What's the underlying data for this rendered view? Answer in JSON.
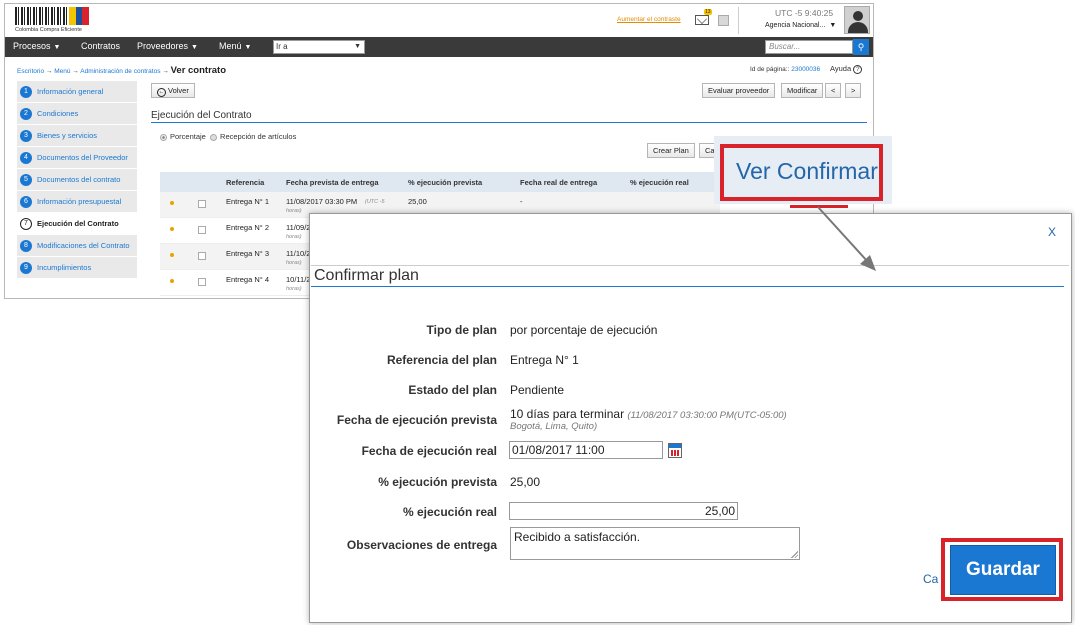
{
  "header": {
    "logo_text": "Colombia Compra Eficiente",
    "aumentar_link": "Aumentar el contraste",
    "mail_badge": "13",
    "utc": "UTC -5 9:40:25",
    "agency": "Agencia Nacional..."
  },
  "nav": {
    "items": [
      "Procesos",
      "Contratos",
      "Proveedores",
      "Menú"
    ],
    "goto_value": "Ir a",
    "search_placeholder": "Buscar..."
  },
  "breadcrumb": {
    "items": [
      "Escritorio",
      "Menú",
      "Administración de contratos"
    ],
    "current": "Ver contrato"
  },
  "page_id": {
    "label": "Id de página::",
    "value": "23000036"
  },
  "help_label": "Ayuda",
  "sidebar": {
    "steps": [
      {
        "num": "1",
        "label": "Información general"
      },
      {
        "num": "2",
        "label": "Condiciones"
      },
      {
        "num": "3",
        "label": "Bienes y servicios"
      },
      {
        "num": "4",
        "label": "Documentos del Proveedor"
      },
      {
        "num": "5",
        "label": "Documentos del contrato"
      },
      {
        "num": "6",
        "label": "Información presupuestal"
      },
      {
        "num": "7",
        "label": "Ejecución del Contrato"
      },
      {
        "num": "8",
        "label": "Modificaciones del Contrato"
      },
      {
        "num": "9",
        "label": "Incumplimientos"
      }
    ]
  },
  "toolbar": {
    "back": "Volver",
    "evaluate": "Evaluar proveedor",
    "modify": "Modificar",
    "prev": "<",
    "next": ">"
  },
  "execution": {
    "title": "Ejecución del Contrato",
    "radio_percent": "Porcentaje",
    "radio_reception": "Recepción de artículos",
    "create_plan": "Crear Plan",
    "cut_button": "Ca"
  },
  "table": {
    "headers": [
      "Referencia",
      "Fecha prevista de entrega",
      "% ejecución prevista",
      "Fecha real de entrega",
      "% ejecución real"
    ],
    "rows": [
      {
        "ref": "Entrega N° 1",
        "date": "11/08/2017 03:30 PM",
        "note": "(UTC -5",
        "note2": "horas)",
        "pct": "25,00",
        "real": "-"
      },
      {
        "ref": "Entrega N° 2",
        "date": "11/09/2",
        "note": "horas)",
        "pct": "",
        "real": ""
      },
      {
        "ref": "Entrega N° 3",
        "date": "11/10/2",
        "note": "horas)",
        "pct": "",
        "real": ""
      },
      {
        "ref": "Entrega N° 4",
        "date": "10/11/2",
        "note": "horas)",
        "pct": "",
        "real": ""
      }
    ]
  },
  "callout": {
    "text": "Ver Confirmar"
  },
  "modal": {
    "close": "X",
    "title": "Confirmar plan",
    "fields": {
      "tipo_label": "Tipo de plan",
      "tipo_value": "por porcentaje de ejecución",
      "ref_label": "Referencia del plan",
      "ref_value": "Entrega N° 1",
      "estado_label": "Estado del plan",
      "estado_value": "Pendiente",
      "fecha_prev_label": "Fecha de ejecución prevista",
      "fecha_prev_value": "10 días para terminar",
      "fecha_prev_detail": "(11/08/2017 03:30:00 PM(UTC-05:00)",
      "fecha_prev_tz": "Bogotá, Lima, Quito)",
      "fecha_real_label": "Fecha de ejecución real",
      "fecha_real_value": "01/08/2017 11:00",
      "pct_prev_label": "% ejecución prevista",
      "pct_prev_value": "25,00",
      "pct_real_label": "% ejecución real",
      "pct_real_value": "25,00",
      "obs_label": "Observaciones de entrega",
      "obs_value": "Recibido a satisfacción."
    },
    "cancel": "Ca",
    "save": "Guardar"
  },
  "colors": {
    "primary_blue": "#1b78d2",
    "navbar": "#3a3a3a",
    "highlight_red": "#d8232a",
    "callout_text": "#2466a8",
    "step_bg": "#e9e9e9"
  }
}
